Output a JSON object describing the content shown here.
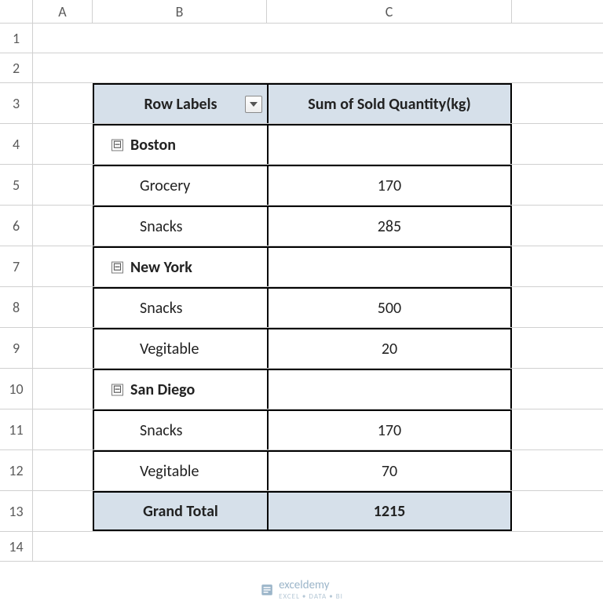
{
  "columns": {
    "A": "A",
    "B": "B",
    "C": "C"
  },
  "row_numbers": [
    "1",
    "2",
    "3",
    "4",
    "5",
    "6",
    "7",
    "8",
    "9",
    "10",
    "11",
    "12",
    "13",
    "14"
  ],
  "pivot": {
    "header_b": "Row Labels",
    "header_c": "Sum of Sold Quantity(kg)",
    "groups": [
      {
        "name": "Boston",
        "items": [
          [
            "Grocery",
            "170"
          ],
          [
            "Snacks",
            "285"
          ]
        ]
      },
      {
        "name": "New York",
        "items": [
          [
            "Snacks",
            "500"
          ],
          [
            "Vegitable",
            "20"
          ]
        ]
      },
      {
        "name": "San Diego",
        "items": [
          [
            "Snacks",
            "170"
          ],
          [
            "Vegitable",
            "70"
          ]
        ]
      }
    ],
    "grand_total_label": "Grand Total",
    "grand_total_value": "1215"
  },
  "chart_data": {
    "type": "table",
    "title": "Sum of Sold Quantity(kg)",
    "rows": [
      [
        "Boston",
        "Grocery",
        170
      ],
      [
        "Boston",
        "Snacks",
        285
      ],
      [
        "New York",
        "Snacks",
        500
      ],
      [
        "New York",
        "Vegitable",
        20
      ],
      [
        "San Diego",
        "Snacks",
        170
      ],
      [
        "San Diego",
        "Vegitable",
        70
      ]
    ],
    "grand_total": 1215
  },
  "watermark": {
    "brand": "exceldemy",
    "tagline": "EXCEL • DATA • BI"
  }
}
